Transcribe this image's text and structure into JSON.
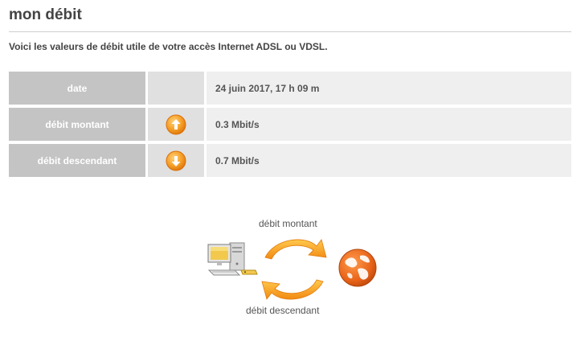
{
  "page": {
    "title": "mon débit",
    "intro": "Voici les valeurs de débit utile de votre accès Internet ADSL ou VDSL."
  },
  "table": {
    "rows": [
      {
        "label": "date",
        "icon": "",
        "value": "24 juin 2017, 17 h 09 m"
      },
      {
        "label": "débit montant",
        "icon": "upload-arrow-icon",
        "value": "0.3 Mbit/s"
      },
      {
        "label": "débit descendant",
        "icon": "download-arrow-icon",
        "value": "0.7 Mbit/s"
      }
    ]
  },
  "diagram": {
    "upload_label": "débit montant",
    "download_label": "débit descendant",
    "icons": [
      "computer-icon",
      "sync-arrows-icon",
      "globe-icon"
    ]
  },
  "colors": {
    "accent_orange": "#f39a1e",
    "label_bg": "#c4c4c4",
    "icon_bg": "#e0e0e0",
    "value_bg": "#efefef"
  }
}
